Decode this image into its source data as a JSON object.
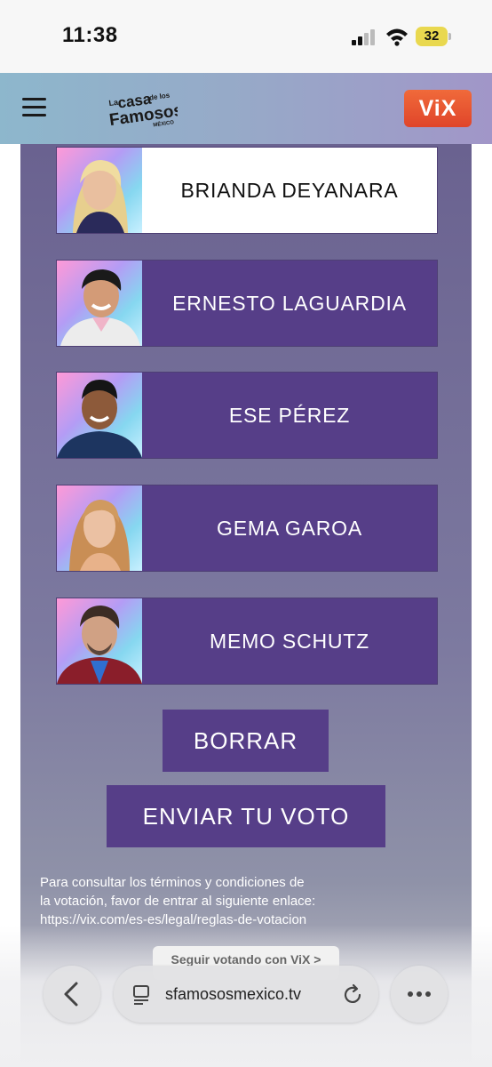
{
  "status": {
    "time": "11:38",
    "battery": "32"
  },
  "header": {
    "vix_label": "ViX",
    "logo_text": [
      "La",
      "casa",
      "de los",
      "Famosos",
      "MÉXICO"
    ]
  },
  "contestants": [
    {
      "name": "BRIANDA DEYANARA",
      "selected": true
    },
    {
      "name": "ERNESTO LAGUARDIA",
      "selected": false
    },
    {
      "name": "ESE PÉREZ",
      "selected": false
    },
    {
      "name": "GEMA GAROA",
      "selected": false
    },
    {
      "name": "MEMO SCHUTZ",
      "selected": false
    }
  ],
  "actions": {
    "clear_label": "BORRAR",
    "submit_label": "ENVIAR TU VOTO"
  },
  "terms": {
    "line1": "Para consultar los términos y condiciones de",
    "line2": "la votación, favor de entrar al siguiente enlace:",
    "link": "https://vix.com/es-es/legal/reglas-de-votacion"
  },
  "overlay": {
    "continue_label": "Seguir votando con ViX >"
  },
  "browser": {
    "url": "sfamososmexico.tv"
  },
  "colors": {
    "accent_purple": "#563e88",
    "vix_orange": "#e9502e"
  }
}
